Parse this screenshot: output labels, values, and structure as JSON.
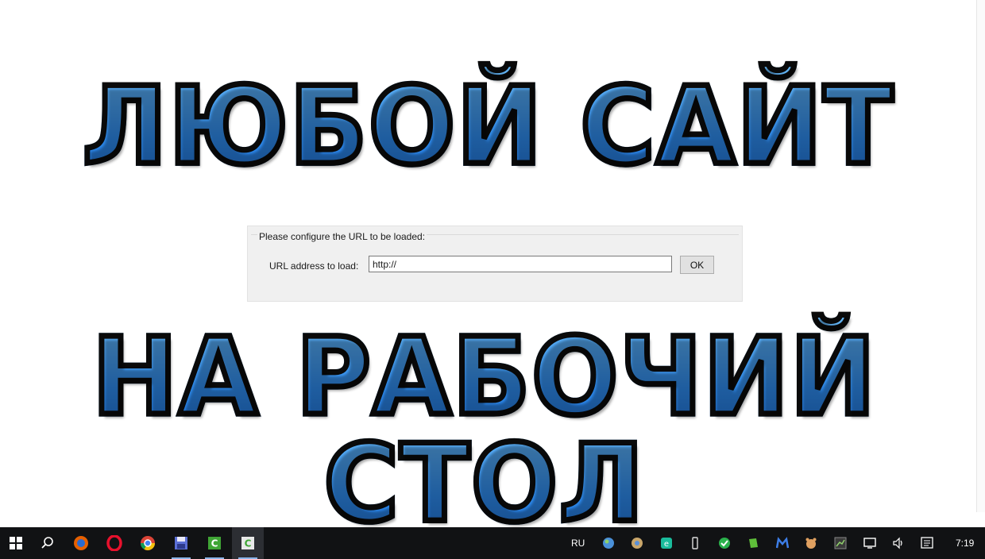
{
  "headline": {
    "line1": "ЛЮБОЙ САЙТ",
    "line2": "НА РАБОЧИЙ СТОЛ"
  },
  "dialog": {
    "group_title": "Please configure the URL to be loaded:",
    "url_label": "URL address to load:",
    "url_value": "http://",
    "ok_label": "OK"
  },
  "taskbar": {
    "language": "RU",
    "time": "7:19",
    "pinned": [
      "start-windows-icon",
      "search-icon",
      "firefox-icon",
      "opera-icon",
      "chrome-icon",
      "save-disk-icon",
      "app-c-icon",
      "app-c-active-icon"
    ],
    "tray": [
      "globe-icon",
      "network-ball-icon",
      "app-tray-icon",
      "usb-icon",
      "green-app-icon",
      "evernote-icon",
      "malwarebytes-icon",
      "bear-app-icon",
      "chart-app-icon",
      "display-icon",
      "volume-icon",
      "notifications-icon"
    ]
  },
  "colors": {
    "headline_fill": "#3b9cff",
    "headline_outline": "#0a0a0a",
    "taskbar_bg": "#111214",
    "dialog_bg": "#f0f0f0"
  }
}
